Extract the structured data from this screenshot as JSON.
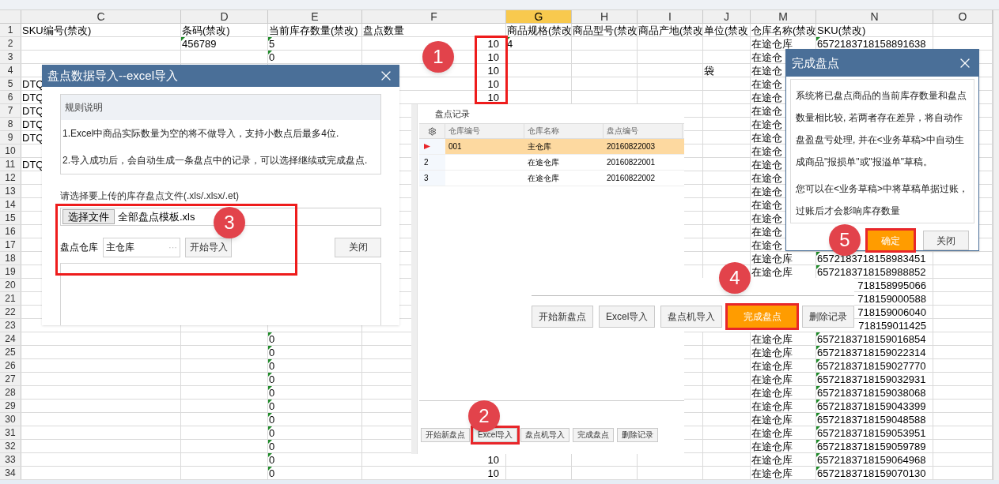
{
  "spreadsheet": {
    "columns": [
      {
        "label": "C",
        "selected": false
      },
      {
        "label": "D",
        "selected": false
      },
      {
        "label": "E",
        "selected": false
      },
      {
        "label": "F",
        "selected": false
      },
      {
        "label": "G",
        "selected": true
      },
      {
        "label": "H",
        "selected": false
      },
      {
        "label": "I",
        "selected": false
      },
      {
        "label": "J",
        "selected": false
      },
      {
        "label": "M",
        "selected": false
      },
      {
        "label": "N",
        "selected": false
      },
      {
        "label": "O",
        "selected": false
      }
    ],
    "rows": [
      {
        "label": "1",
        "cells": {
          "C": {
            "text": "SKU编号(禁改)"
          },
          "D": {
            "text": "条码(禁改)"
          },
          "E": {
            "text": "当前库存数量(禁改)"
          },
          "F": {
            "text": "盘点数量"
          },
          "G": {
            "text": "商品规格(禁改"
          },
          "H": {
            "text": "商品型号(禁改"
          },
          "I": {
            "text": "商品产地(禁改"
          },
          "J": {
            "text": "单位(禁改"
          },
          "M": {
            "text": "仓库名称(禁改"
          },
          "N": {
            "text": "SKU(禁改)"
          }
        }
      },
      {
        "label": "2",
        "cells": {
          "D": {
            "text": "456789",
            "flag": true
          },
          "E": {
            "text": "5",
            "flag": true
          },
          "F": {
            "text": "10",
            "kind": "number"
          },
          "G": {
            "text": "4",
            "flag": true
          },
          "M": {
            "text": "在途仓库"
          },
          "N": {
            "text": "6572183718158891638",
            "flag": true
          }
        }
      },
      {
        "label": "3",
        "cells": {
          "E": {
            "text": "0",
            "flag": true
          },
          "F": {
            "text": "10",
            "kind": "number"
          },
          "M": {
            "text": "在途仓"
          }
        }
      },
      {
        "label": "4",
        "cells": {
          "F": {
            "text": "10",
            "kind": "number"
          },
          "J": {
            "text": "袋"
          },
          "M": {
            "text": "在途仓"
          }
        }
      },
      {
        "label": "5",
        "cells": {
          "C": {
            "text": "DTQ"
          },
          "F": {
            "text": "10",
            "kind": "number"
          },
          "M": {
            "text": "在途仓"
          }
        }
      },
      {
        "label": "6",
        "cells": {
          "C": {
            "text": "DTQ"
          },
          "F": {
            "text": "10",
            "kind": "number"
          },
          "M": {
            "text": "在途仓"
          }
        }
      },
      {
        "label": "7",
        "cells": {
          "C": {
            "text": "DTQ"
          },
          "M": {
            "text": "在途仓"
          }
        }
      },
      {
        "label": "8",
        "cells": {
          "C": {
            "text": "DTQ"
          },
          "M": {
            "text": "在途仓"
          }
        }
      },
      {
        "label": "9",
        "cells": {
          "C": {
            "text": "DTQ"
          },
          "M": {
            "text": "在途仓"
          }
        }
      },
      {
        "label": "10",
        "cells": {
          "M": {
            "text": "在途仓"
          }
        }
      },
      {
        "label": "11",
        "cells": {
          "C": {
            "text": "DTQ"
          },
          "M": {
            "text": "在途仓"
          }
        }
      },
      {
        "label": "12",
        "cells": {
          "M": {
            "text": "在途仓"
          }
        }
      },
      {
        "label": "13",
        "cells": {
          "M": {
            "text": "在途仓"
          }
        }
      },
      {
        "label": "14",
        "cells": {
          "M": {
            "text": "在途仓"
          }
        }
      },
      {
        "label": "15",
        "cells": {
          "M": {
            "text": "在途仓"
          }
        }
      },
      {
        "label": "16",
        "cells": {
          "M": {
            "text": "在途仓"
          }
        }
      },
      {
        "label": "17",
        "cells": {
          "M": {
            "text": "在途仓"
          }
        }
      },
      {
        "label": "18",
        "cells": {
          "M": {
            "text": "在途仓库"
          },
          "N": {
            "text": "6572183718158983451",
            "flag": true
          }
        }
      },
      {
        "label": "19",
        "cells": {
          "M": {
            "text": "在途仓库"
          },
          "N": {
            "text": "6572183718158988852",
            "flag": true
          }
        }
      },
      {
        "label": "20",
        "cells": {
          "N": {
            "text": "718158995066",
            "kind": "number"
          }
        }
      },
      {
        "label": "21",
        "cells": {
          "N": {
            "text": "718159000588",
            "kind": "number"
          }
        }
      },
      {
        "label": "22",
        "cells": {
          "N": {
            "text": "718159006040",
            "kind": "number"
          }
        }
      },
      {
        "label": "23",
        "cells": {
          "N": {
            "text": "718159011425",
            "kind": "number"
          }
        }
      },
      {
        "label": "24",
        "cells": {
          "E": {
            "text": "0",
            "flag": true
          },
          "M": {
            "text": "在途仓库"
          },
          "N": {
            "text": "6572183718159016854",
            "flag": true
          }
        }
      },
      {
        "label": "25",
        "cells": {
          "E": {
            "text": "0",
            "flag": true
          },
          "M": {
            "text": "在途仓库"
          },
          "N": {
            "text": "6572183718159022314",
            "flag": true
          }
        }
      },
      {
        "label": "26",
        "cells": {
          "E": {
            "text": "0",
            "flag": true
          },
          "M": {
            "text": "在途仓库"
          },
          "N": {
            "text": "6572183718159027770",
            "flag": true
          }
        }
      },
      {
        "label": "27",
        "cells": {
          "E": {
            "text": "0",
            "flag": true
          },
          "M": {
            "text": "在途仓库"
          },
          "N": {
            "text": "6572183718159032931",
            "flag": true
          }
        }
      },
      {
        "label": "28",
        "cells": {
          "E": {
            "text": "0",
            "flag": true
          },
          "M": {
            "text": "在途仓库"
          },
          "N": {
            "text": "6572183718159038068",
            "flag": true
          }
        }
      },
      {
        "label": "29",
        "cells": {
          "E": {
            "text": "0",
            "flag": true
          },
          "M": {
            "text": "在途仓库"
          },
          "N": {
            "text": "6572183718159043399",
            "flag": true
          }
        }
      },
      {
        "label": "30",
        "cells": {
          "E": {
            "text": "0",
            "flag": true
          },
          "M": {
            "text": "在途仓库"
          },
          "N": {
            "text": "6572183718159048588",
            "flag": true
          }
        }
      },
      {
        "label": "31",
        "cells": {
          "E": {
            "text": "0",
            "flag": true
          },
          "M": {
            "text": "在途仓库"
          },
          "N": {
            "text": "6572183718159053951",
            "flag": true
          }
        }
      },
      {
        "label": "32",
        "cells": {
          "E": {
            "text": "0",
            "flag": true
          },
          "M": {
            "text": "在途仓库"
          },
          "N": {
            "text": "6572183718159059789",
            "flag": true
          }
        }
      },
      {
        "label": "33",
        "cells": {
          "E": {
            "text": "0",
            "flag": true
          },
          "F": {
            "text": "10",
            "kind": "number"
          },
          "M": {
            "text": "在途仓库"
          },
          "N": {
            "text": "6572183718159064968",
            "flag": true
          }
        }
      },
      {
        "label": "34",
        "cells": {
          "E": {
            "text": "0",
            "flag": true
          },
          "F": {
            "text": "10",
            "kind": "number"
          },
          "M": {
            "text": "在途仓库"
          },
          "N": {
            "text": "6572183718159070130",
            "flag": true
          }
        }
      }
    ]
  },
  "import_dialog": {
    "title": "盘点数据导入--excel导入",
    "rules_heading": "规则说明",
    "rules": [
      "1.Excel中商品实际数量为空的将不做导入，支持小数点后最多4位.",
      "2.导入成功后，会自动生成一条盘点中的记录，可以选择继续或完成盘点."
    ],
    "file_prompt": "请选择要上传的库存盘点文件(.xls/.xlsx/.et)",
    "choose_button": "选择文件",
    "file_name": "全部盘点模板.xls",
    "warehouse_label": "盘点仓库",
    "warehouse_value": "主仓库",
    "more": "···",
    "start_button": "开始导入",
    "close_button": "关闭"
  },
  "records_panel": {
    "title": "盘点记录",
    "columns": [
      "仓库编号",
      "仓库名称",
      "盘点编号"
    ],
    "rows": [
      {
        "selected": true,
        "code": "001",
        "name": "主仓库",
        "number": "20160822003"
      },
      {
        "selected": false,
        "index": "2",
        "name": "在途仓库",
        "number": "20160822001"
      },
      {
        "selected": false,
        "index": "3",
        "name": "在途仓库",
        "number": "20160822002"
      }
    ],
    "buttons": [
      {
        "label": "开始新盘点",
        "kind": "normal",
        "highlighted": false
      },
      {
        "label": "Excel导入",
        "kind": "normal",
        "highlighted": true
      },
      {
        "label": "盘点机导入",
        "kind": "normal",
        "highlighted": false
      },
      {
        "label": "完成盘点",
        "kind": "normal",
        "highlighted": false
      },
      {
        "label": "删除记录",
        "kind": "normal",
        "highlighted": false
      }
    ]
  },
  "zoomed_buttons": [
    {
      "label": "开始新盘点",
      "kind": "normal",
      "highlighted": false
    },
    {
      "label": "Excel导入",
      "kind": "normal",
      "highlighted": false
    },
    {
      "label": "盘点机导入",
      "kind": "normal",
      "highlighted": false
    },
    {
      "label": "完成盘点",
      "kind": "primary",
      "highlighted": true
    },
    {
      "label": "删除记录",
      "kind": "normal",
      "highlighted": false
    }
  ],
  "finish_dialog": {
    "title": "完成盘点",
    "paragraphs": [
      "系统将已盘点商品的当前库存数量和盘点数量相比较, 若两者存在差异，将自动作盘盈盘亏处理, 并在<业务草稿>中自动生成商品\"报损单\"或\"报溢单\"草稿。",
      "您可以在<业务草稿>中将草稿单据过账，过账后才会影响库存数量"
    ],
    "buttons": [
      {
        "label": "确定",
        "kind": "primary",
        "highlighted": true
      },
      {
        "label": "关闭",
        "kind": "normal",
        "highlighted": false
      }
    ]
  },
  "badges": [
    "1",
    "2",
    "3",
    "4",
    "5"
  ]
}
